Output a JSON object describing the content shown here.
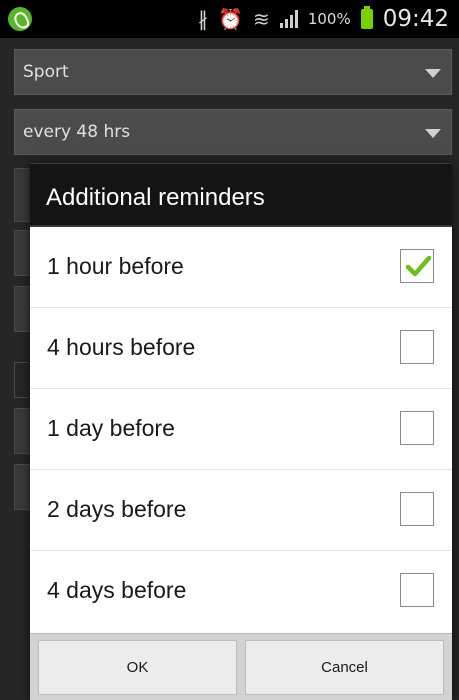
{
  "status_bar": {
    "battery_percent": "100%",
    "time": "09:42",
    "icons": [
      "app-runner-icon",
      "bluetooth-icon",
      "alarm-icon",
      "wifi-icon",
      "signal-icon",
      "battery-icon"
    ]
  },
  "background": {
    "category_spinner": "Sport",
    "interval_spinner": "every 48 hrs"
  },
  "dialog": {
    "title": "Additional reminders",
    "options": [
      {
        "label": "1 hour before",
        "checked": true
      },
      {
        "label": "4 hours before",
        "checked": false
      },
      {
        "label": "1 day before",
        "checked": false
      },
      {
        "label": "2 days before",
        "checked": false
      },
      {
        "label": "4 days before",
        "checked": false
      }
    ],
    "ok_label": "OK",
    "cancel_label": "Cancel"
  },
  "colors": {
    "check_green": "#6cbd1e",
    "battery_green": "#78d000"
  }
}
